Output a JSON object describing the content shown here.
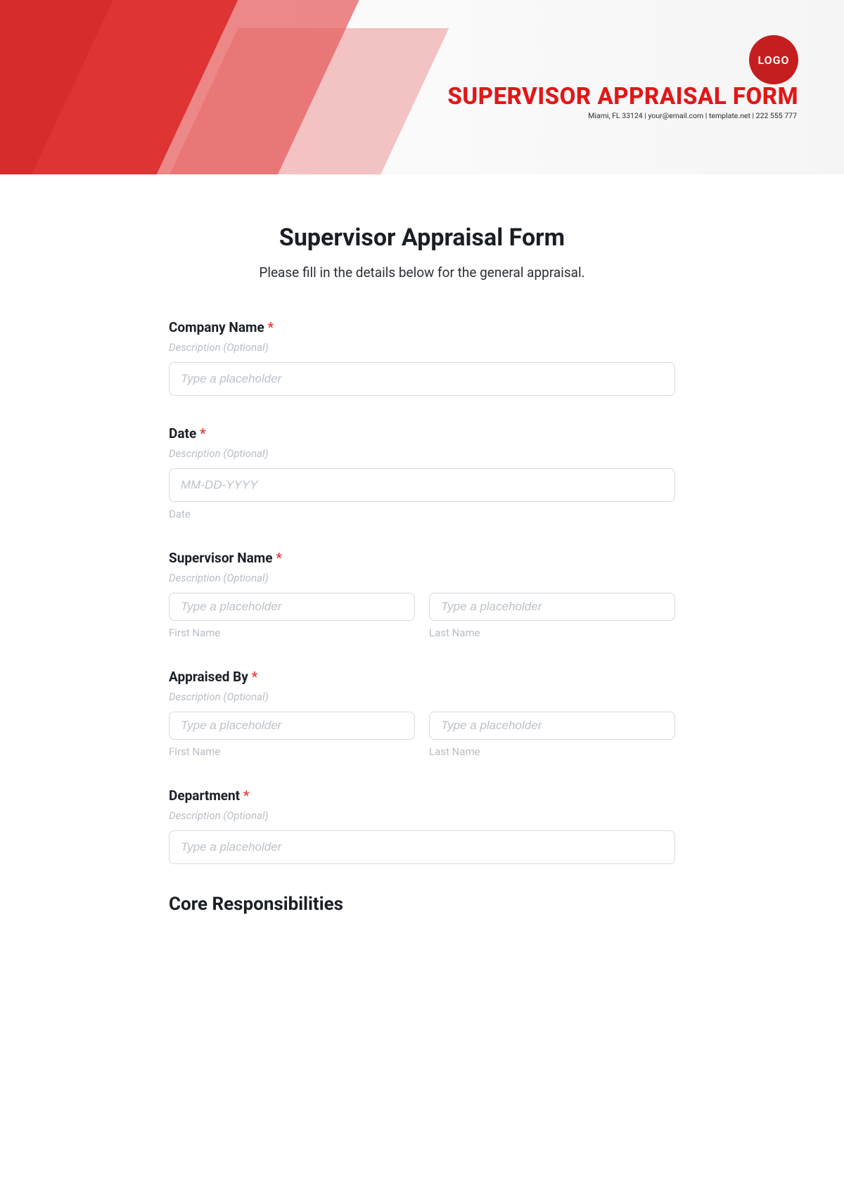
{
  "header": {
    "logo_text": "LOGO",
    "title": "SUPERVISOR APPRAISAL FORM",
    "contact": "Miami, FL 33124 | your@email.com | template.net | 222 555 777"
  },
  "form": {
    "title": "Supervisor Appraisal Form",
    "subtitle": "Please fill in the details below for the general appraisal.",
    "fields": {
      "company": {
        "label": "Company Name",
        "required": "*",
        "desc": "Description (Optional)",
        "placeholder": "Type a placeholder"
      },
      "date": {
        "label": "Date",
        "required": "*",
        "desc": "Description (Optional)",
        "placeholder": "MM-DD-YYYY",
        "sub": "Date"
      },
      "supervisor": {
        "label": "Supervisor Name",
        "required": "*",
        "desc": "Description (Optional)",
        "first_placeholder": "Type a placeholder",
        "last_placeholder": "Type a placeholder",
        "first_sub": "First Name",
        "last_sub": "Last Name"
      },
      "appraised": {
        "label": "Appraised By",
        "required": "*",
        "desc": "Description (Optional)",
        "first_placeholder": "Type a placeholder",
        "last_placeholder": "Type a placeholder",
        "first_sub": "First Name",
        "last_sub": "Last Name"
      },
      "department": {
        "label": "Department",
        "required": "*",
        "desc": "Description (Optional)",
        "placeholder": "Type a placeholder"
      }
    },
    "section_core": "Core Responsibilities"
  }
}
